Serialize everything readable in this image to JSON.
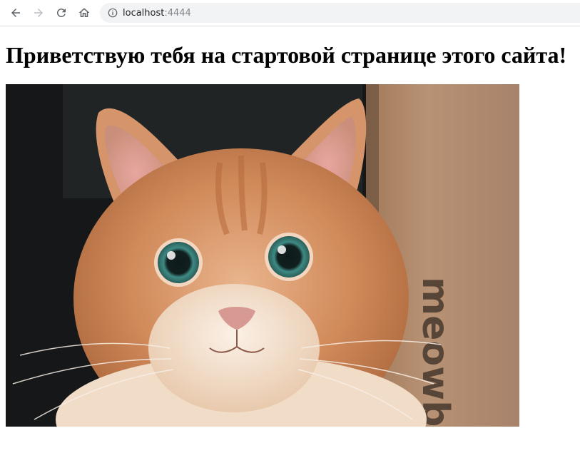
{
  "browser": {
    "url_host": "localhost",
    "url_port": ":4444",
    "icons": {
      "back": "arrow-left-icon",
      "forward": "arrow-right-icon",
      "reload": "reload-icon",
      "home": "home-icon",
      "site_info": "info-icon"
    }
  },
  "page": {
    "title": "Приветствую тебя на стартовой странице этого сайта!",
    "image": {
      "box_text": "meowb"
    }
  },
  "colors": {
    "toolbar_icon": "#5f6368",
    "toolbar_icon_disabled": "#bdc1c6",
    "omnibox_bg": "#f1f3f4",
    "url_host": "#202124",
    "url_port": "#80868b",
    "title": "#000000"
  }
}
